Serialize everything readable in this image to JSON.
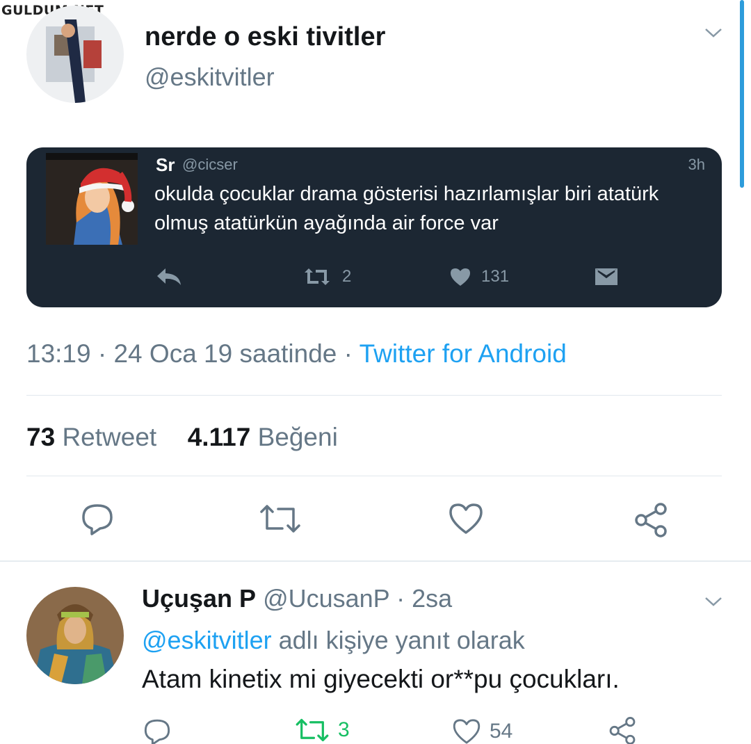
{
  "watermark": "GULDUM.NET",
  "tweet": {
    "author_name": "nerde o eski tivitler",
    "author_handle": "@eskitvitler",
    "time": "13:19",
    "sep1": "·",
    "date": "24 Oca 19 saatinde",
    "sep2": "·",
    "source": "Twitter for Android",
    "retweet_count": "73",
    "retweet_label": "Retweet",
    "like_count": "4.117",
    "like_label": "Beğeni"
  },
  "quoted_tweet": {
    "name": "Sr",
    "handle": "@cicser",
    "time": "3h",
    "text": "okulda çocuklar drama gösterisi hazırlamışlar biri atatürk olmuş atatürkün ayağında air force var",
    "retweets": "2",
    "likes": "131"
  },
  "reply": {
    "name": "Uçuşan P",
    "handle": "@UcusanP",
    "sep": "·",
    "time": "2sa",
    "mention": "@eskitvitler",
    "reply_to_suffix": "adlı kişiye yanıt olarak",
    "text": "Atam kinetix mi giyecekti or**pu çocukları.",
    "retweets": "3",
    "likes": "54"
  },
  "colors": {
    "link": "#1da1f2",
    "muted": "#657786",
    "card_bg": "#1c2733",
    "retweet_green": "#17bf63"
  },
  "icons": [
    "chevron-down-icon",
    "reply-icon",
    "retweet-icon",
    "heart-icon",
    "share-icon",
    "dm-icon"
  ]
}
